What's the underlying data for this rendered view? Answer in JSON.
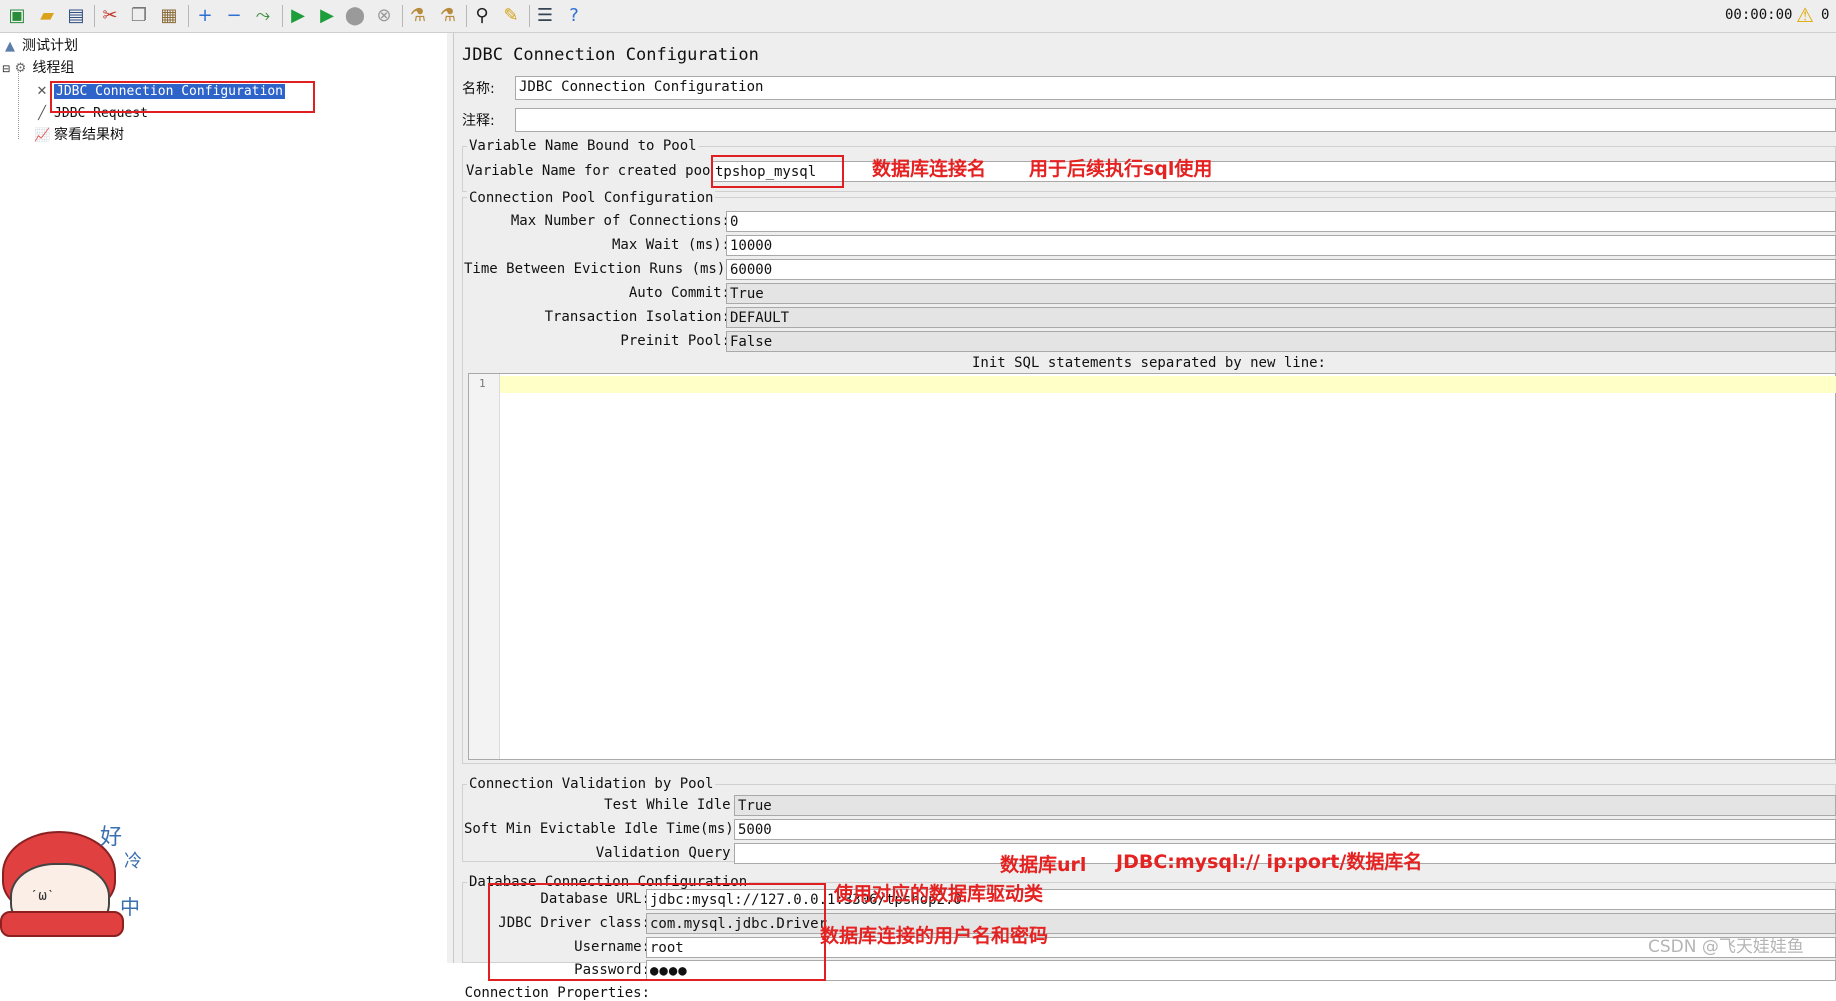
{
  "toolbar": {
    "timer": "00:00:00",
    "warning_count": "0",
    "icons": [
      "templates-icon",
      "open-icon",
      "save-icon",
      "cut-icon",
      "copy-icon",
      "paste-icon",
      "expand-icon",
      "collapse-icon",
      "toggle-icon",
      "start-icon",
      "start-no-pauses-icon",
      "stop-icon",
      "shutdown-icon",
      "clear-icon",
      "clear-all-icon",
      "search-icon",
      "reset-search-icon",
      "function-helper-icon",
      "help-icon"
    ]
  },
  "tree": {
    "root": "测试计划",
    "thread_group": "线程组",
    "items": [
      "JDBC Connection Configuration",
      "JDBC Request",
      "察看结果树"
    ]
  },
  "panel": {
    "title": "JDBC Connection Configuration",
    "name_label": "名称:",
    "name_value": "JDBC Connection Configuration",
    "comment_label": "注释:",
    "comment_value": "",
    "pool_group": {
      "title": "Variable Name Bound to Pool",
      "var_label": "Variable Name for created pool",
      "var_value": "tpshop_mysql"
    },
    "conn_pool": {
      "title": "Connection Pool Configuration",
      "max_conn_label": "Max Number of Connections:",
      "max_conn": "0",
      "max_wait_label": "Max Wait (ms):",
      "max_wait": "10000",
      "eviction_label": "Time Between Eviction Runs (ms):",
      "eviction": "60000",
      "auto_commit_label": "Auto Commit:",
      "auto_commit": "True",
      "isolation_label": "Transaction Isolation:",
      "isolation": "DEFAULT",
      "preinit_label": "Preinit Pool:",
      "preinit": "False",
      "init_sql_label": "Init SQL statements separated by new line:",
      "line_number": "1"
    },
    "validation": {
      "title": "Connection Validation by Pool",
      "test_idle_label": "Test While Idle:",
      "test_idle": "True",
      "soft_min_label": "Soft Min Evictable Idle Time(ms):",
      "soft_min": "5000",
      "query_label": "Validation Query:",
      "query": ""
    },
    "db_conf": {
      "title": "Database Connection Configuration",
      "url_label": "Database URL:",
      "url": "jdbc:mysql://127.0.0.1:3306/tpshop2.0",
      "driver_label": "JDBC Driver class:",
      "driver": "com.mysql.jdbc.Driver",
      "user_label": "Username:",
      "user": "root",
      "pass_label": "Password:",
      "pass": "●●●●",
      "props_label": "Connection Properties:"
    }
  },
  "annotations": {
    "pool_name": "数据库连接名",
    "pool_usage": "用于后续执行sql使用",
    "db_url": "数据库url",
    "url_format": "JDBC:mysql://  ip:port/数据库名",
    "driver": "使用对应的数据库驱动类",
    "credentials": "数据库连接的用户名和密码"
  },
  "watermark": "CSDN @飞天娃娃鱼",
  "sticker_text": [
    "好",
    "冷",
    "中"
  ],
  "colors": {
    "annotation_red": "#e52222",
    "selection_blue": "#2e63c9",
    "editor_line": "#ffffc8"
  }
}
